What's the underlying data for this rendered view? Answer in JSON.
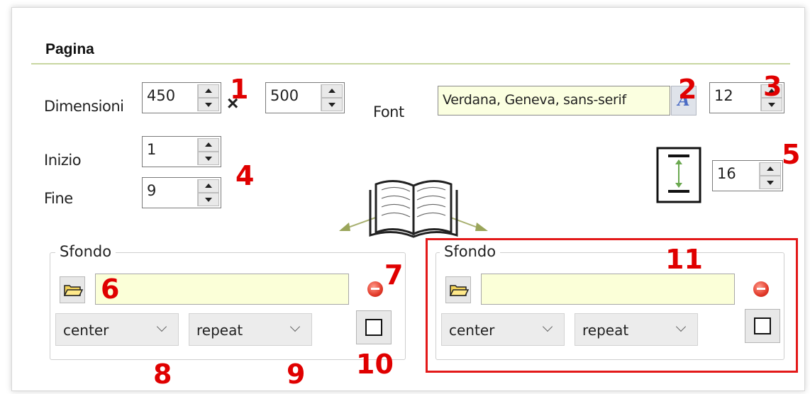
{
  "section": {
    "title": "Pagina"
  },
  "dimensions": {
    "label": "Dimensioni",
    "width": "450",
    "separator": "×",
    "height": "500"
  },
  "font": {
    "label": "Font",
    "value": "Verdana, Geneva, sans-serif",
    "button_glyph": "A",
    "size": "12"
  },
  "pages": {
    "start_label": "Inizio",
    "start": "1",
    "end_label": "Fine",
    "end": "9"
  },
  "line_height": {
    "icon": "line-height-icon",
    "value": "16"
  },
  "book": {
    "icon": "open-book-icon"
  },
  "background_left": {
    "title": "Sfondo",
    "path": "",
    "position": "center",
    "repeat": "repeat"
  },
  "background_right": {
    "title": "Sfondo",
    "path": "",
    "position": "center",
    "repeat": "repeat"
  },
  "markers": [
    "1",
    "2",
    "3",
    "4",
    "5",
    "6",
    "7",
    "8",
    "9",
    "10",
    "11"
  ],
  "colors": {
    "marker": "#e00000",
    "highlight": "#e31919",
    "input_fill": "#fbffd8",
    "accent_line": "#c8d6a0"
  }
}
